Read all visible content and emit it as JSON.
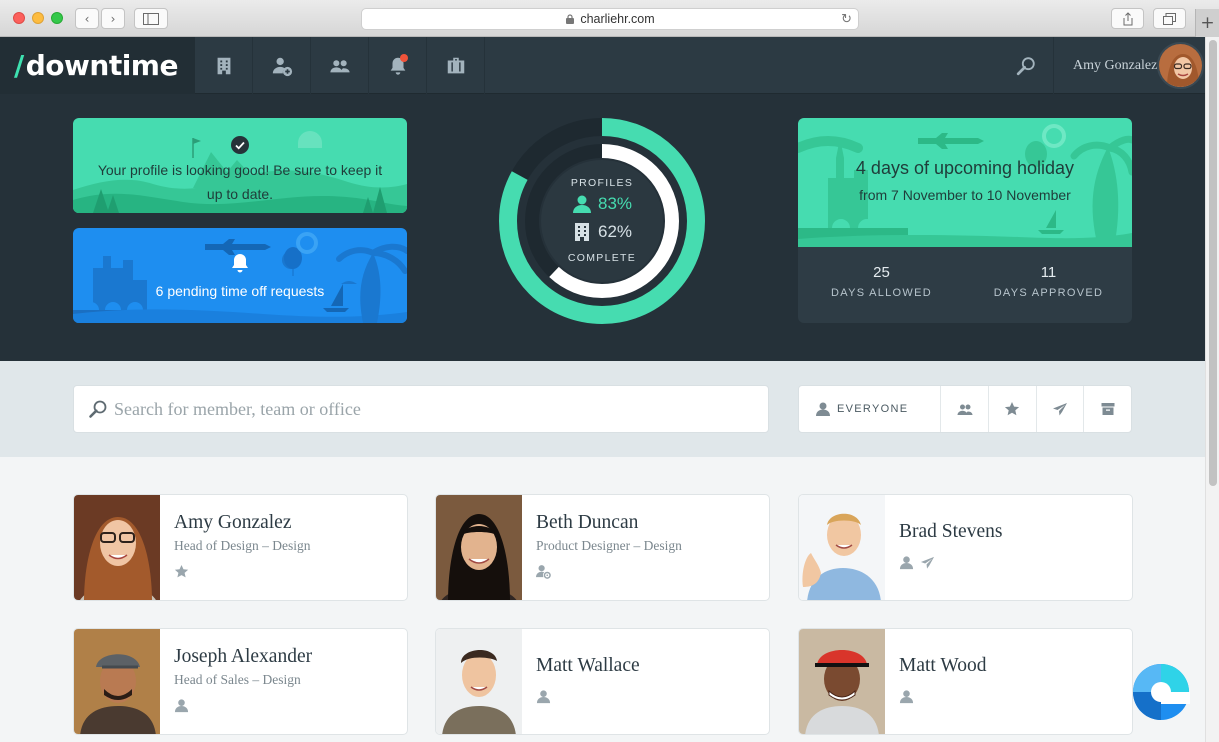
{
  "browser": {
    "url": "charliehr.com"
  },
  "nav": {
    "logo_slash": "/",
    "logo_text": "downtime",
    "icons": [
      "building-icon",
      "add-user-icon",
      "team-icon",
      "bell-icon",
      "briefcase-icon"
    ],
    "user_name": "Amy Gonzalez"
  },
  "dashboard": {
    "profile_card": {
      "line1": "Your profile is looking good! Be sure to keep it",
      "line2": "up to date."
    },
    "pending_card": {
      "text": "6 pending time off requests"
    },
    "donut": {
      "top_label": "PROFILES",
      "people_pct": "83%",
      "office_pct": "62%",
      "bottom_label": "COMPLETE",
      "people_fraction": 0.83,
      "office_fraction": 0.62
    },
    "holiday_card": {
      "title": "4 days of upcoming holiday",
      "subtitle": "from 7 November to 10 November",
      "days_allowed": "25",
      "days_allowed_label": "DAYS ALLOWED",
      "days_approved": "11",
      "days_approved_label": "DAYS APPROVED"
    }
  },
  "search": {
    "placeholder": "Search for member, team or office"
  },
  "filters": {
    "everyone_label": "EVERYONE"
  },
  "people": [
    {
      "name": "Amy Gonzalez",
      "role": "Head of Design – Design",
      "icons": [
        "star-icon"
      ]
    },
    {
      "name": "Beth Duncan",
      "role": "Product Designer – Design",
      "icons": [
        "user-settings-icon"
      ]
    },
    {
      "name": "Brad Stevens",
      "role": "",
      "icons": [
        "user-icon",
        "plane-icon"
      ]
    },
    {
      "name": "Joseph Alexander",
      "role": "Head of Sales – Design",
      "icons": [
        "user-icon"
      ]
    },
    {
      "name": "Matt Wallace",
      "role": "",
      "icons": [
        "user-icon"
      ]
    },
    {
      "name": "Matt Wood",
      "role": "",
      "icons": [
        "user-icon"
      ]
    }
  ],
  "colors": {
    "accent": "#46dcb0",
    "navy": "#253139",
    "blue": "#1e8ef0"
  }
}
